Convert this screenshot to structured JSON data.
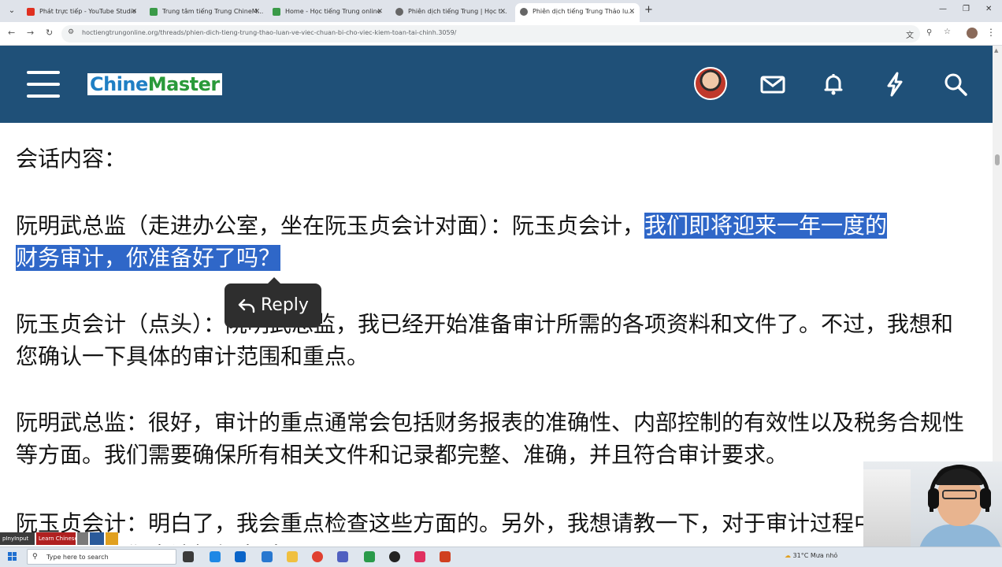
{
  "browser": {
    "tabs": [
      {
        "title": "Phát trực tiếp - YouTube Studio",
        "favicon_color": "#e03020"
      },
      {
        "title": "Trung tâm tiếng Trung ChineM...",
        "favicon_color": "#3a9a48"
      },
      {
        "title": "Home - Học tiếng Trung online",
        "favicon_color": "#3a9a48"
      },
      {
        "title": "Phiên dịch tiếng Trung | Học t...",
        "favicon_color": "#555555"
      },
      {
        "title": "Phiên dịch tiếng Trung Thảo lu...",
        "favicon_color": "#555555",
        "active": true
      }
    ],
    "url": "hoctiengtrungonline.org/threads/phien-dich-tieng-trung-thao-luan-ve-viec-chuan-bi-cho-viec-kiem-toan-tai-chinh.3059/"
  },
  "site": {
    "logo_part1": "Chine",
    "logo_part2": "Master",
    "brand_color": "#1f5078",
    "header_icons": [
      "menu-icon",
      "avatar",
      "mail-icon",
      "bell-icon",
      "bolt-icon",
      "search-icon"
    ]
  },
  "article": {
    "p0": "会话内容：",
    "p1_plain": "阮明武总监（走进办公室，坐在阮玉贞会计对面）：阮玉贞会计，",
    "p1_selected_a": "我们即将迎来一年一度的",
    "p1_selected_b": "财务审计，你准备好了吗？",
    "p2": "阮玉贞会计（点头）：阮明武总监，我已经开始准备审计所需的各项资料和文件了。不过，我想和您确认一下具体的审计范围和重点。",
    "p3": "阮明武总监：很好，审计的重点通常会包括财务报表的准确性、内部控制的有效性以及税务合规性等方面。我们需要确保所有相关文件和记录都完整、准确，并且符合审计要求。",
    "p4": "阮玉贞会计：明白了，我会重点检查这些方面的。另外，我想请教一下，对于审计过程中可能出现的问题，我们应该如何应对？",
    "selection_color": "#2f67c8"
  },
  "reply_popup": {
    "label": "Reply"
  },
  "taskbar": {
    "pinned": [
      {
        "label": "pInyInput",
        "color": "#3c3c3c"
      },
      {
        "label": "Learn Chinese",
        "color": "#b02020"
      }
    ],
    "search_placeholder": "Type here to search",
    "weather": "31°C  Mưa nhỏ"
  }
}
